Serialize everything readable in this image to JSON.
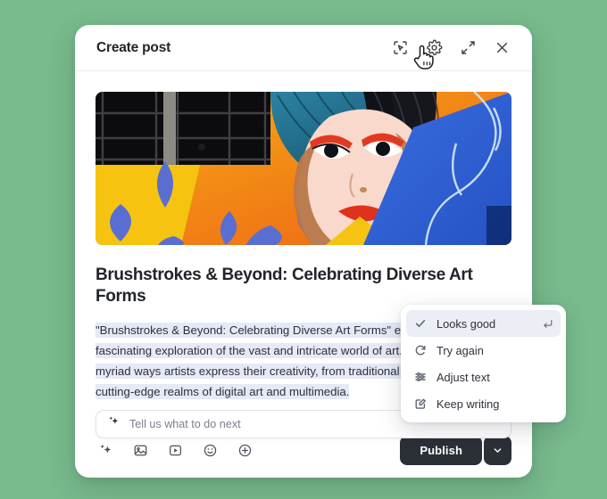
{
  "theme": {
    "page_background": "#79bb8d",
    "surface": "#ffffff",
    "text_primary": "#21242b",
    "text_muted": "#7b7f8b",
    "selection_highlight": "#e6e9f6",
    "menu_active_bg": "#eceef5",
    "publish_button_bg": "#2b2f36"
  },
  "header": {
    "title": "Create post",
    "actions": [
      {
        "name": "ai-select-icon",
        "label": "AI select"
      },
      {
        "name": "gear-icon",
        "label": "Settings"
      },
      {
        "name": "expand-icon",
        "label": "Expand"
      },
      {
        "name": "close-icon",
        "label": "Close"
      }
    ]
  },
  "cursor": {
    "type": "pointing-hand"
  },
  "artwork": {
    "alt": "Colorful street mural of a woman's face with teal and black hair beside orange, yellow and blue panels",
    "colors": {
      "window": "#0d0d10",
      "orange": "#f2701d",
      "yellow": "#f5c410",
      "leaf_blue": "#5a6fd4",
      "skin": "#f7d6c8",
      "hair_teal": "#1f6f8f",
      "hair_black": "#13131a",
      "lips_red": "#e0331f",
      "panel_blue": "#2f62d8",
      "vine_line": "#cfe0f5"
    }
  },
  "post": {
    "title": "Brushstrokes & Beyond: Celebrating Diverse Art Forms",
    "body": "\"Brushstrokes & Beyond: Celebrating Diverse Art Forms\" encapsulates a fascinating exploration of the vast and intricate world of art. This delves into the myriad ways artists express their creativity, from traditional sculpting to the cutting-edge realms of digital art and multimedia."
  },
  "prompt": {
    "icon": "sparkle-icon",
    "placeholder": "Tell us what to do next",
    "value": ""
  },
  "footer": {
    "tools": [
      {
        "name": "sparkle-icon",
        "label": "AI assist"
      },
      {
        "name": "image-icon",
        "label": "Add image"
      },
      {
        "name": "video-icon",
        "label": "Add video"
      },
      {
        "name": "emoji-icon",
        "label": "Add emoji"
      },
      {
        "name": "plus-icon",
        "label": "More"
      }
    ],
    "publish_label": "Publish",
    "publish_caret": "chevron-down-icon"
  },
  "ai_menu": {
    "items": [
      {
        "icon": "check-icon",
        "label": "Looks good",
        "shortcut": "↵",
        "active": true
      },
      {
        "icon": "refresh-icon",
        "label": "Try again",
        "shortcut": "",
        "active": false
      },
      {
        "icon": "sliders-icon",
        "label": "Adjust text",
        "shortcut": "",
        "active": false
      },
      {
        "icon": "pencil-icon",
        "label": "Keep writing",
        "shortcut": "",
        "active": false
      }
    ]
  }
}
